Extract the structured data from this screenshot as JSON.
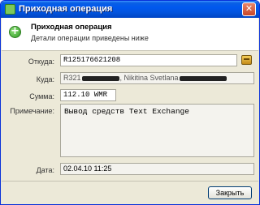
{
  "window": {
    "title": "Приходная операция",
    "close_glyph": "✕"
  },
  "header": {
    "title": "Приходная операция",
    "subtitle": "Детали операции приведены ниже",
    "icon_glyph": "+"
  },
  "fields": {
    "from_label": "Откуда:",
    "from_value": "R125176621208",
    "to_label": "Куда:",
    "to_value_prefix": "R321",
    "to_value_name": ", Nikitina Svetlana",
    "amount_label": "Сумма:",
    "amount_value": "112.10 WMR",
    "note_label": "Примечание:",
    "note_value": "Вывод средств Text Exchange",
    "date_label": "Дата:",
    "date_value": "02.04.10 11:25"
  },
  "buttons": {
    "close_label": "Закрыть"
  }
}
